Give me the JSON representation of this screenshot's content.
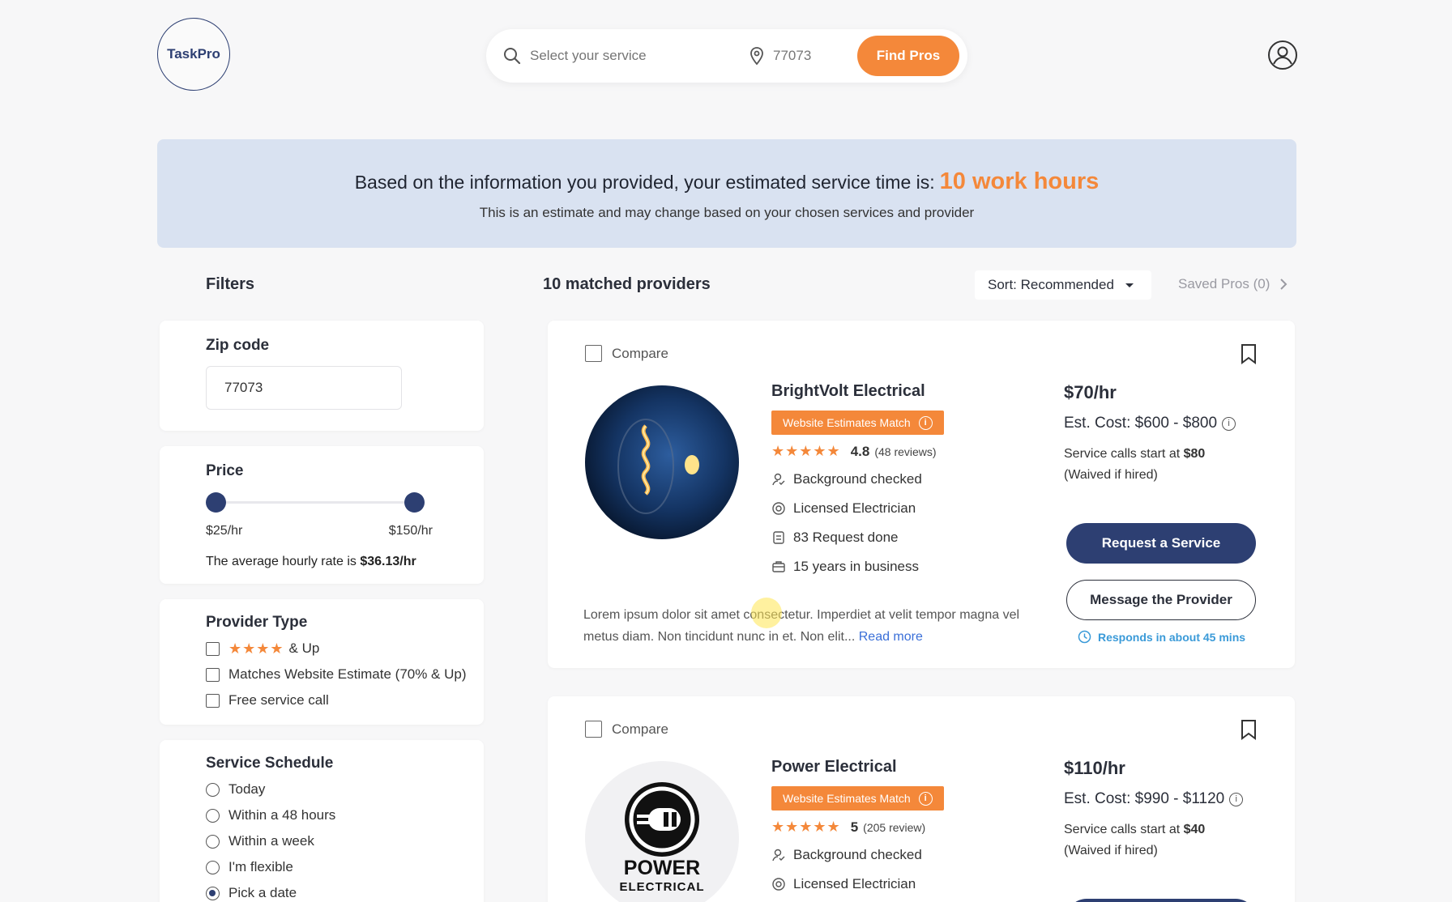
{
  "header": {
    "logo_text": "TaskPro",
    "search_placeholder": "Select your service",
    "zip_value": "77073",
    "find_button": "Find Pros"
  },
  "banner": {
    "main_text": "Based on the information you provided, your estimated service time is:",
    "highlight": "10 work hours",
    "subtext": "This is an estimate and may change based on your chosen services and provider"
  },
  "filters": {
    "title": "Filters",
    "zip": {
      "label": "Zip code",
      "value": "77073"
    },
    "price": {
      "label": "Price",
      "min_label": "$25/hr",
      "max_label": "$150/hr",
      "avg_prefix": "The average hourly rate is",
      "avg_value": "$36.13/hr",
      "min_pos": 0.0,
      "max_pos": 1.0
    },
    "provider_type": {
      "label": "Provider Type",
      "stars_label": "& Up",
      "options": [
        "Matches Website Estimate (70% & Up)",
        "Free service call"
      ]
    },
    "schedule": {
      "label": "Service Schedule",
      "options": [
        "Today",
        "Within a 48 hours",
        "Within a week",
        "I'm flexible",
        "Pick a date"
      ],
      "selected": "Pick a date"
    }
  },
  "results": {
    "count_label": "10 matched providers",
    "sort_label": "Sort: Recommended",
    "saved_label": "Saved Pros (0)",
    "compare_label": "Compare",
    "badge_label": "Website Estimates Match",
    "request_button": "Request a Service",
    "message_button": "Message the Provider",
    "providers": [
      {
        "name": "BrightVolt Electrical",
        "rating": "4.8",
        "reviews": "(48 reviews)",
        "features": [
          "Background checked",
          "Licensed Electrician",
          "83 Request done",
          "15 years in business"
        ],
        "rate": "$70/hr",
        "est_cost": "Est. Cost: $600 - $800",
        "calls_prefix": "Service calls start at",
        "calls_price": "$80",
        "calls_suffix": "(Waived if hired)",
        "description": "Lorem ipsum dolor sit amet consectetur. Imperdiet at velit tempor magna vel metus diam. Non tincidunt nunc in et. Non elit...",
        "read_more": "Read more",
        "responds": "Responds in about 45 mins"
      },
      {
        "name": "Power Electrical",
        "rating": "5",
        "reviews": "(205 review)",
        "features": [
          "Background checked",
          "Licensed Electrician"
        ],
        "rate": "$110/hr",
        "est_cost": "Est. Cost: $990 - $1120",
        "calls_prefix": "Service calls start at",
        "calls_price": "$40",
        "calls_suffix": "(Waived if hired)",
        "logo_line1": "POWER",
        "logo_line2": "ELECTRICAL"
      }
    ]
  },
  "colors": {
    "accent": "#f4883a",
    "primary": "#2d3f72",
    "banner": "#d9e2f1"
  }
}
